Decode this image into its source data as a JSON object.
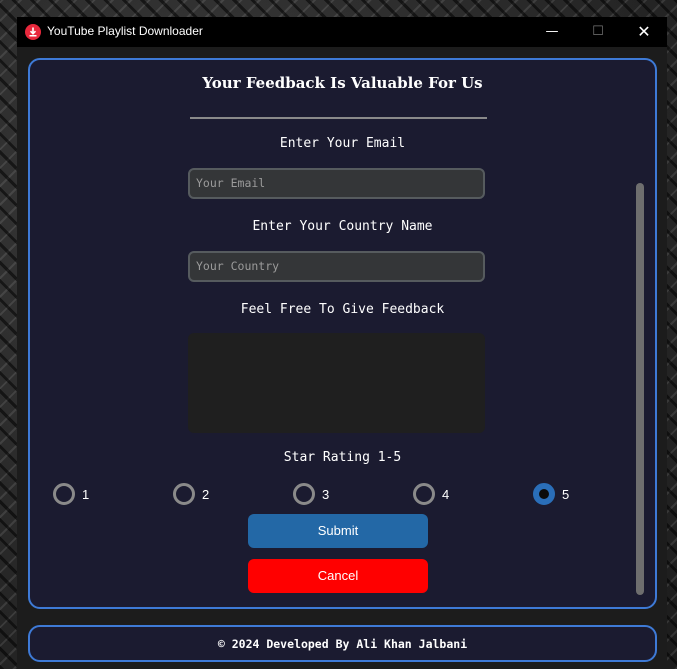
{
  "window": {
    "title": "YouTube Playlist Downloader",
    "controls": {
      "minimize": "—",
      "maximize": "☐",
      "close": "✕"
    }
  },
  "form": {
    "heading": "Your Feedback Is Valuable For Us",
    "email_label": "Enter Your Email",
    "email_placeholder": "Your Email",
    "country_label": "Enter Your Country Name",
    "country_placeholder": "Your Country",
    "feedback_label": "Feel Free To Give Feedback",
    "rating_label": "Star Rating 1-5",
    "rating_options": [
      "1",
      "2",
      "3",
      "4",
      "5"
    ],
    "rating_selected": "5",
    "submit_label": "Submit",
    "cancel_label": "Cancel"
  },
  "footer": {
    "text": "© 2024 Developed By Ali Khan Jalbani"
  },
  "colors": {
    "frame_border": "#3e7ad6",
    "submit": "#2368a6",
    "cancel": "#ff0000",
    "radio_selected": "#2a6eb8"
  }
}
